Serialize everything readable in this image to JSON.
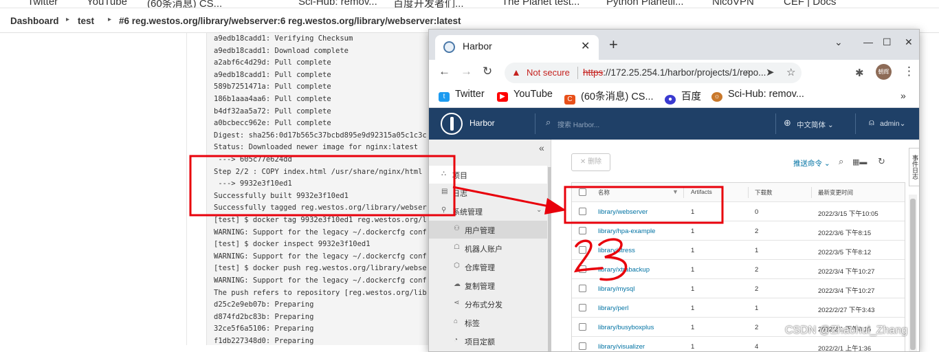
{
  "bg_bookmarks": [
    "Twitter",
    "YouTube",
    "(60条消息) CS...",
    "Sci-Hub: remov...",
    "百度开发者们...",
    "The Planet test...",
    "Python Planetli...",
    "NicoVPN",
    "CEF | Docs"
  ],
  "breadcrumb": {
    "items": [
      "Dashboard",
      "test",
      "#6 reg.westos.org/library/webserver:6 reg.westos.org/library/webserver:latest"
    ]
  },
  "console": {
    "lines": [
      "a9edb18cadd1: Verifying Checksum",
      "a9edb18cadd1: Download complete",
      "a2abf6c4d29d: Pull complete",
      "a9edb18cadd1: Pull complete",
      "589b7251471a: Pull complete",
      "186b1aaa4aa6: Pull complete",
      "b4df32aa5a72: Pull complete",
      "a0bcbecc962e: Pull complete",
      "Digest: sha256:0d17b565c37bcbd895e9d92315a05c1c3c",
      "Status: Downloaded newer image for nginx:latest",
      " ---> 605c77e624dd",
      "Step 2/2 : COPY index.html /usr/share/nginx/html",
      " ---> 9932e3f10ed1",
      "Successfully built 9932e3f10ed1",
      "Successfully tagged reg.westos.org/library/webser",
      "[test] $ docker tag 9932e3f10ed1 reg.westos.org/l",
      "WARNING: Support for the legacy ~/.dockercfg conf",
      "[test] $ docker inspect 9932e3f10ed1",
      "WARNING: Support for the legacy ~/.dockercfg conf",
      "[test] $ docker push reg.westos.org/library/webse",
      "WARNING: Support for the legacy ~/.dockercfg conf",
      "The push refers to repository [reg.westos.org/lib",
      "d25c2e9eb07b: Preparing",
      "d874fd2bc83b: Preparing",
      "32ce5f6a5106: Preparing",
      "f1db227348d0: Preparing"
    ]
  },
  "browser": {
    "tab_title": "Harbor",
    "not_secure": "Not secure",
    "url_scheme": "https",
    "url_rest": "://172.25.254.1/harbor/projects/1/repo...",
    "avatar_text": "朝辉",
    "bookmarks": [
      "Twitter",
      "YouTube",
      "(60条消息) CS...",
      "百度",
      "Sci-Hub: remov..."
    ]
  },
  "harbor": {
    "brand": "Harbor",
    "search_placeholder": "搜索 Harbor...",
    "language": "中文简体",
    "user": "admin",
    "sidebar": {
      "projects": "项目",
      "logs": "日志",
      "admin": "系统管理",
      "children": [
        "用户管理",
        "机器人账户",
        "仓库管理",
        "复制管理",
        "分布式分发",
        "标签",
        "项目定额"
      ]
    },
    "toolbar": {
      "delete": "删除",
      "push_command": "推送命令"
    },
    "side_tab": "事件日志",
    "table": {
      "headers": {
        "name": "名称",
        "artifacts": "Artifacts",
        "pulls": "下载数",
        "updated": "最新变更时间"
      },
      "rows": [
        {
          "name": "library/webserver",
          "artifacts": "1",
          "pulls": "0",
          "updated": "2022/3/15 下午10:05"
        },
        {
          "name": "library/hpa-example",
          "artifacts": "1",
          "pulls": "2",
          "updated": "2022/3/6 下午8:15"
        },
        {
          "name": "library/stress",
          "artifacts": "1",
          "pulls": "1",
          "updated": "2022/3/5 下午8:12"
        },
        {
          "name": "library/xtrabackup",
          "artifacts": "1",
          "pulls": "2",
          "updated": "2022/3/4 下午10:27"
        },
        {
          "name": "library/mysql",
          "artifacts": "1",
          "pulls": "2",
          "updated": "2022/3/4 下午10:27"
        },
        {
          "name": "library/perl",
          "artifacts": "1",
          "pulls": "1",
          "updated": "2022/2/27 下午3:43"
        },
        {
          "name": "library/busyboxplus",
          "artifacts": "1",
          "pulls": "2",
          "updated": "2022/2/1 下午8:15"
        },
        {
          "name": "library/visualizer",
          "artifacts": "1",
          "pulls": "4",
          "updated": "2022/2/1 上午1:36"
        }
      ]
    }
  },
  "annotation": {
    "handwriting": "23",
    "color": "#e8000b"
  },
  "watermark": "CSDN @Zhaohui_Zhang"
}
